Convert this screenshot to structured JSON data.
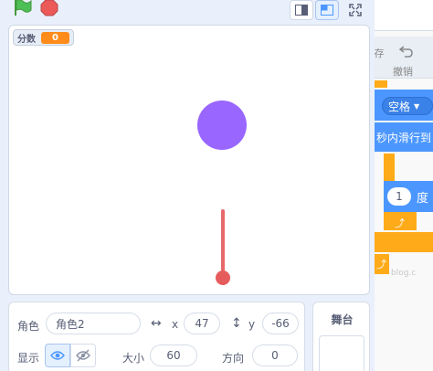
{
  "stage_header": {
    "flag_icon": "green-flag-icon",
    "stop_icon": "stop-icon",
    "small_stage_icon": "small-stage-icon",
    "normal_stage_icon": "normal-stage-icon",
    "fullscreen_icon": "fullscreen-icon",
    "flag_color": "#4cbf56",
    "stop_color": "#ec5959"
  },
  "stage": {
    "monitor_label": "分数",
    "monitor_value": "0",
    "ball_color": "#9966ff",
    "paddle_color": "#e86a6a"
  },
  "code_area": {
    "partial_label": "存",
    "undo_label": "撤销",
    "key_pill": "空格",
    "glide_text": "秒内滑行到",
    "degree_value": "1",
    "degree_label": "度",
    "watermark": "blog.c"
  },
  "sprite_info": {
    "sprite_label": "角色",
    "sprite_name": "角色2",
    "x_label": "x",
    "x_value": "47",
    "y_label": "y",
    "y_value": "-66",
    "show_label": "显示",
    "size_label": "大小",
    "size_value": "60",
    "direction_label": "方向",
    "direction_value": "0"
  },
  "stage_panel": {
    "label": "舞台"
  }
}
